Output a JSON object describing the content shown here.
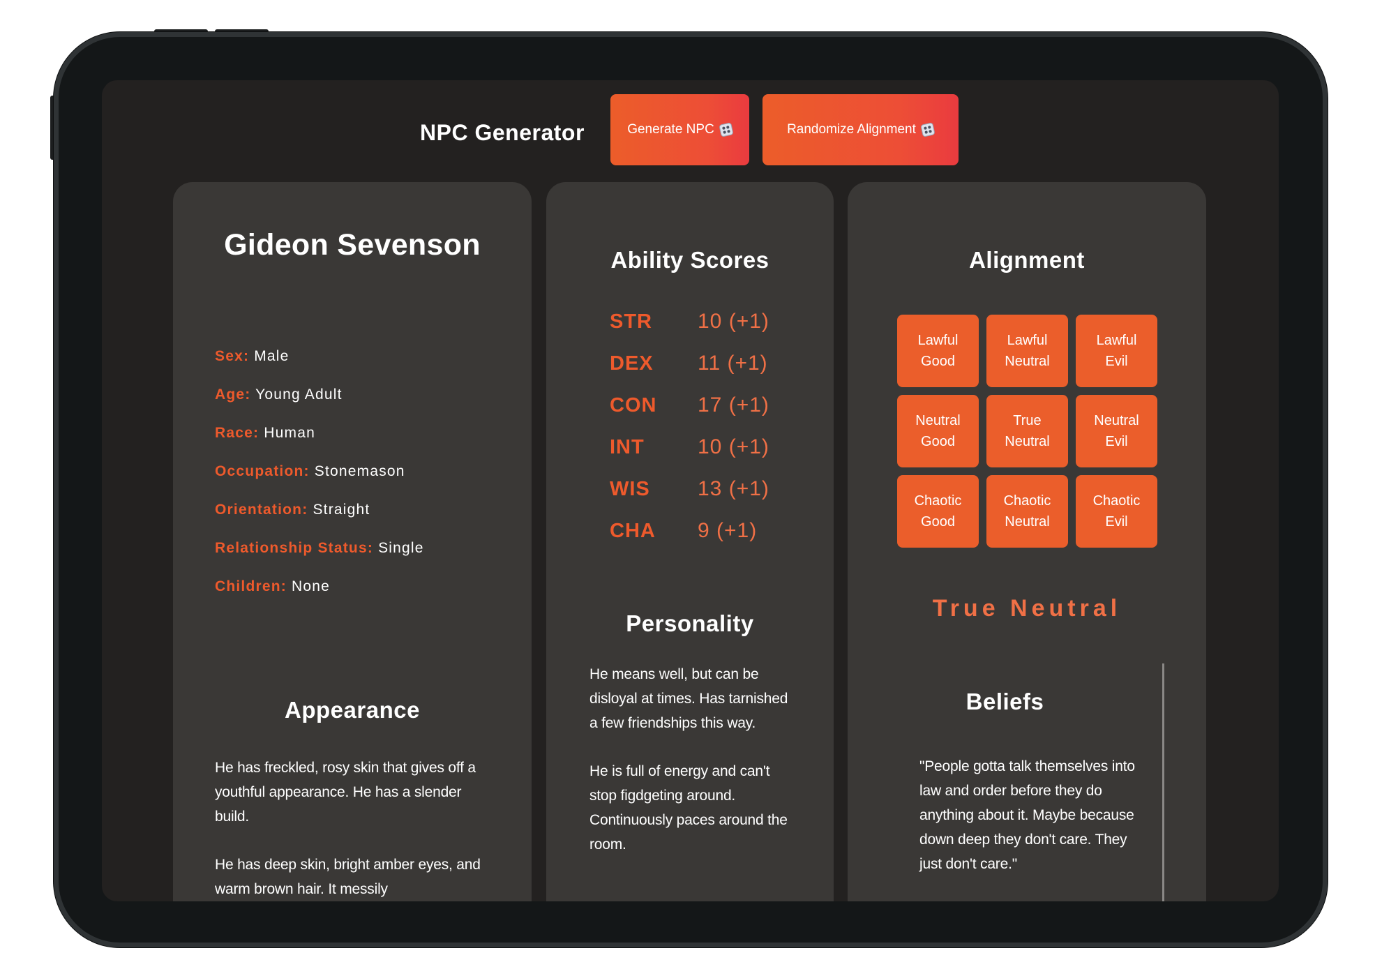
{
  "app": {
    "title": "NPC Generator",
    "generate_label": "Generate NPC",
    "randomize_label": "Randomize Alignment"
  },
  "npc": {
    "name": "Gideon Sevenson",
    "details": [
      {
        "label": "Sex:",
        "value": "Male"
      },
      {
        "label": "Age:",
        "value": "Young Adult"
      },
      {
        "label": "Race:",
        "value": "Human"
      },
      {
        "label": "Occupation:",
        "value": "Stonemason"
      },
      {
        "label": "Orientation:",
        "value": "Straight"
      },
      {
        "label": "Relationship Status:",
        "value": "Single"
      },
      {
        "label": "Children:",
        "value": "None"
      }
    ]
  },
  "appearance": {
    "heading": "Appearance",
    "paragraphs": [
      "He has freckled, rosy skin that gives off a youthful appearance. He has a slender build.",
      "He has deep skin, bright amber eyes, and warm brown hair. It messily"
    ]
  },
  "abilities": {
    "heading": "Ability Scores",
    "scores": [
      {
        "name": "STR",
        "value": "10 (+1)"
      },
      {
        "name": "DEX",
        "value": "11 (+1)"
      },
      {
        "name": "CON",
        "value": "17 (+1)"
      },
      {
        "name": "INT",
        "value": "10 (+1)"
      },
      {
        "name": "WIS",
        "value": "13 (+1)"
      },
      {
        "name": "CHA",
        "value": "9 (+1)"
      }
    ]
  },
  "personality": {
    "heading": "Personality",
    "paragraphs": [
      "He means well, but can be disloyal at times. Has tarnished a few friendships this way.",
      "He is full of energy and can't stop figdgeting around. Continuously paces around the room."
    ]
  },
  "alignment": {
    "heading": "Alignment",
    "options": [
      "Lawful\nGood",
      "Lawful\nNeutral",
      "Lawful\nEvil",
      "Neutral\nGood",
      "True\nNeutral",
      "Neutral\nEvil",
      "Chaotic\nGood",
      "Chaotic\nNeutral",
      "Chaotic\nEvil"
    ],
    "current": "True Neutral"
  },
  "beliefs": {
    "heading": "Beliefs",
    "text": "\"People gotta talk themselves into law and order before they do anything about it. Maybe because down deep they don't care. They just don't care.\""
  },
  "colors": {
    "accent": "#ec5d2a",
    "button_gradient_end": "#ea3b3f",
    "screen_bg": "#232120",
    "card_bg": "#3a3836"
  }
}
